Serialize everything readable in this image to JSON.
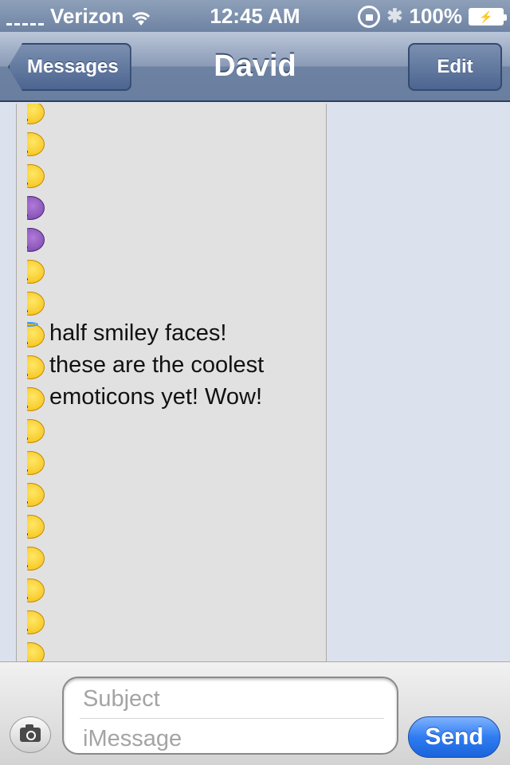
{
  "status_bar": {
    "carrier": "Verizon",
    "time": "12:45 AM",
    "battery_percent": "100%",
    "icons": [
      "signal-icon",
      "wifi-icon",
      "rotation-lock-icon",
      "bluetooth-icon",
      "battery-icon"
    ]
  },
  "nav": {
    "back_label": "Messages",
    "title": "David",
    "edit_label": "Edit"
  },
  "conversation": {
    "message_lines": [
      "half smiley faces!",
      "these are the coolest",
      "emoticons yet! Wow!"
    ],
    "emoji_column": [
      "dizzy-face",
      "smiley",
      "smiley",
      "devil",
      "devil",
      "neutral",
      "neutral",
      "halo",
      "smiley",
      "expressionless",
      "grin",
      "grin",
      "heart-eyes",
      "kiss",
      "smirk",
      "surprised",
      "smiley",
      "tears"
    ]
  },
  "compose": {
    "subject_placeholder": "Subject",
    "message_placeholder": "iMessage",
    "send_label": "Send"
  },
  "colors": {
    "nav_blue": "#6d82a2",
    "send_blue": "#2f7cf1",
    "background": "#dbe2ed"
  }
}
